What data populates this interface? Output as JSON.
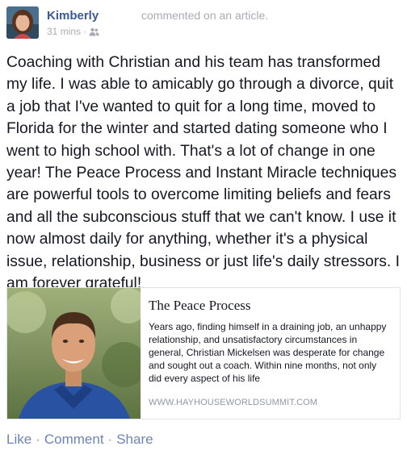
{
  "post": {
    "author": "Kimberly",
    "action": "commented on an article.",
    "time": "31 mins",
    "separator": "·",
    "audience_icon": "friends-icon",
    "text": "Coaching with Christian and his team has transformed my life. I was able to amicably go through a divorce, quit a job that I've wanted to quit for a long time, moved to Florida for the winter and started dating someone who I went to high school with. That's a lot of change in one year! The Peace Process and Instant Miracle techniques are powerful tools to overcome limiting beliefs and fears and all the subconscious stuff that we can't know. I use it now almost daily for anything, whether it's a physical issue, relationship, business or just life's daily stressors. I am forever grateful!"
  },
  "link": {
    "title": "The Peace Process",
    "description": "Years ago, finding himself in a draining job, an unhappy relationship, and unsatisfactory circumstances in general, Christian Mickelsen was desperate for change and sought out a coach. Within nine months, not only did every aspect of his life",
    "domain": "WWW.HAYHOUSEWORLDSUMMIT.COM"
  },
  "actions": {
    "like": "Like",
    "comment": "Comment",
    "share": "Share",
    "separator": "·"
  },
  "colors": {
    "link_blue": "#3b5998",
    "action_blue": "#6d84b4",
    "meta_gray": "#a8abb1",
    "text": "#141823"
  }
}
